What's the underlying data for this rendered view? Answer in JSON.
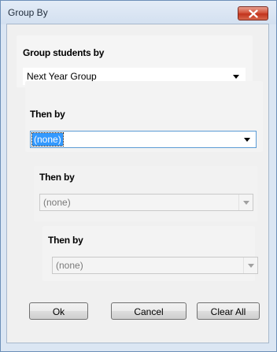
{
  "window": {
    "title": "Group By"
  },
  "groups": [
    {
      "label": "Group students by",
      "value": "Next Year Group",
      "state": "normal"
    },
    {
      "label": "Then by",
      "value": "(none)",
      "state": "focused"
    },
    {
      "label": "Then by",
      "value": "(none)",
      "state": "disabled"
    },
    {
      "label": "Then by",
      "value": "(none)",
      "state": "disabled"
    }
  ],
  "buttons": {
    "ok": "Ok",
    "cancel": "Cancel",
    "clear_all": "Clear All"
  },
  "colors": {
    "selection": "#3399ff",
    "close_button": "#c2341d",
    "frame": "#dbe6f3"
  }
}
